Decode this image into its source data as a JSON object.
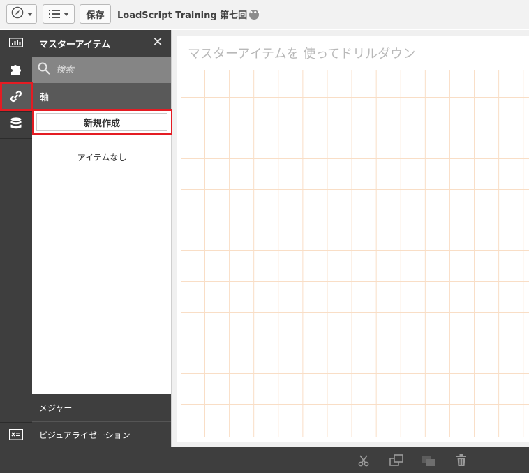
{
  "toolbar": {
    "save_label": "保存",
    "app_title": "LoadScript Training 第七回",
    "more_glyph": "•••"
  },
  "rail": {
    "items": [
      {
        "icon": "chart-icon",
        "active": false
      },
      {
        "icon": "puzzle-icon",
        "active": false
      },
      {
        "icon": "link-icon",
        "active": true
      },
      {
        "icon": "database-icon",
        "active": false
      }
    ],
    "bottom_icon": "variable-icon"
  },
  "panel": {
    "title": "マスターアイテム",
    "search_placeholder": "検索",
    "dimensions_label": "軸",
    "create_label": "新規作成",
    "empty_label": "アイテムなし",
    "measures_label": "メジャー",
    "visualizations_label": "ビジュアライゼーション"
  },
  "sheet": {
    "title": "マスターアイテムを 使ってドリルダウン"
  },
  "bottom_bar": {
    "icons": [
      "cut-icon",
      "copy-icon",
      "paste-icon",
      "delete-icon"
    ]
  },
  "colors": {
    "dark": "#3e3e3e",
    "highlight": "#e41c23",
    "grid": "#f9dec6"
  }
}
